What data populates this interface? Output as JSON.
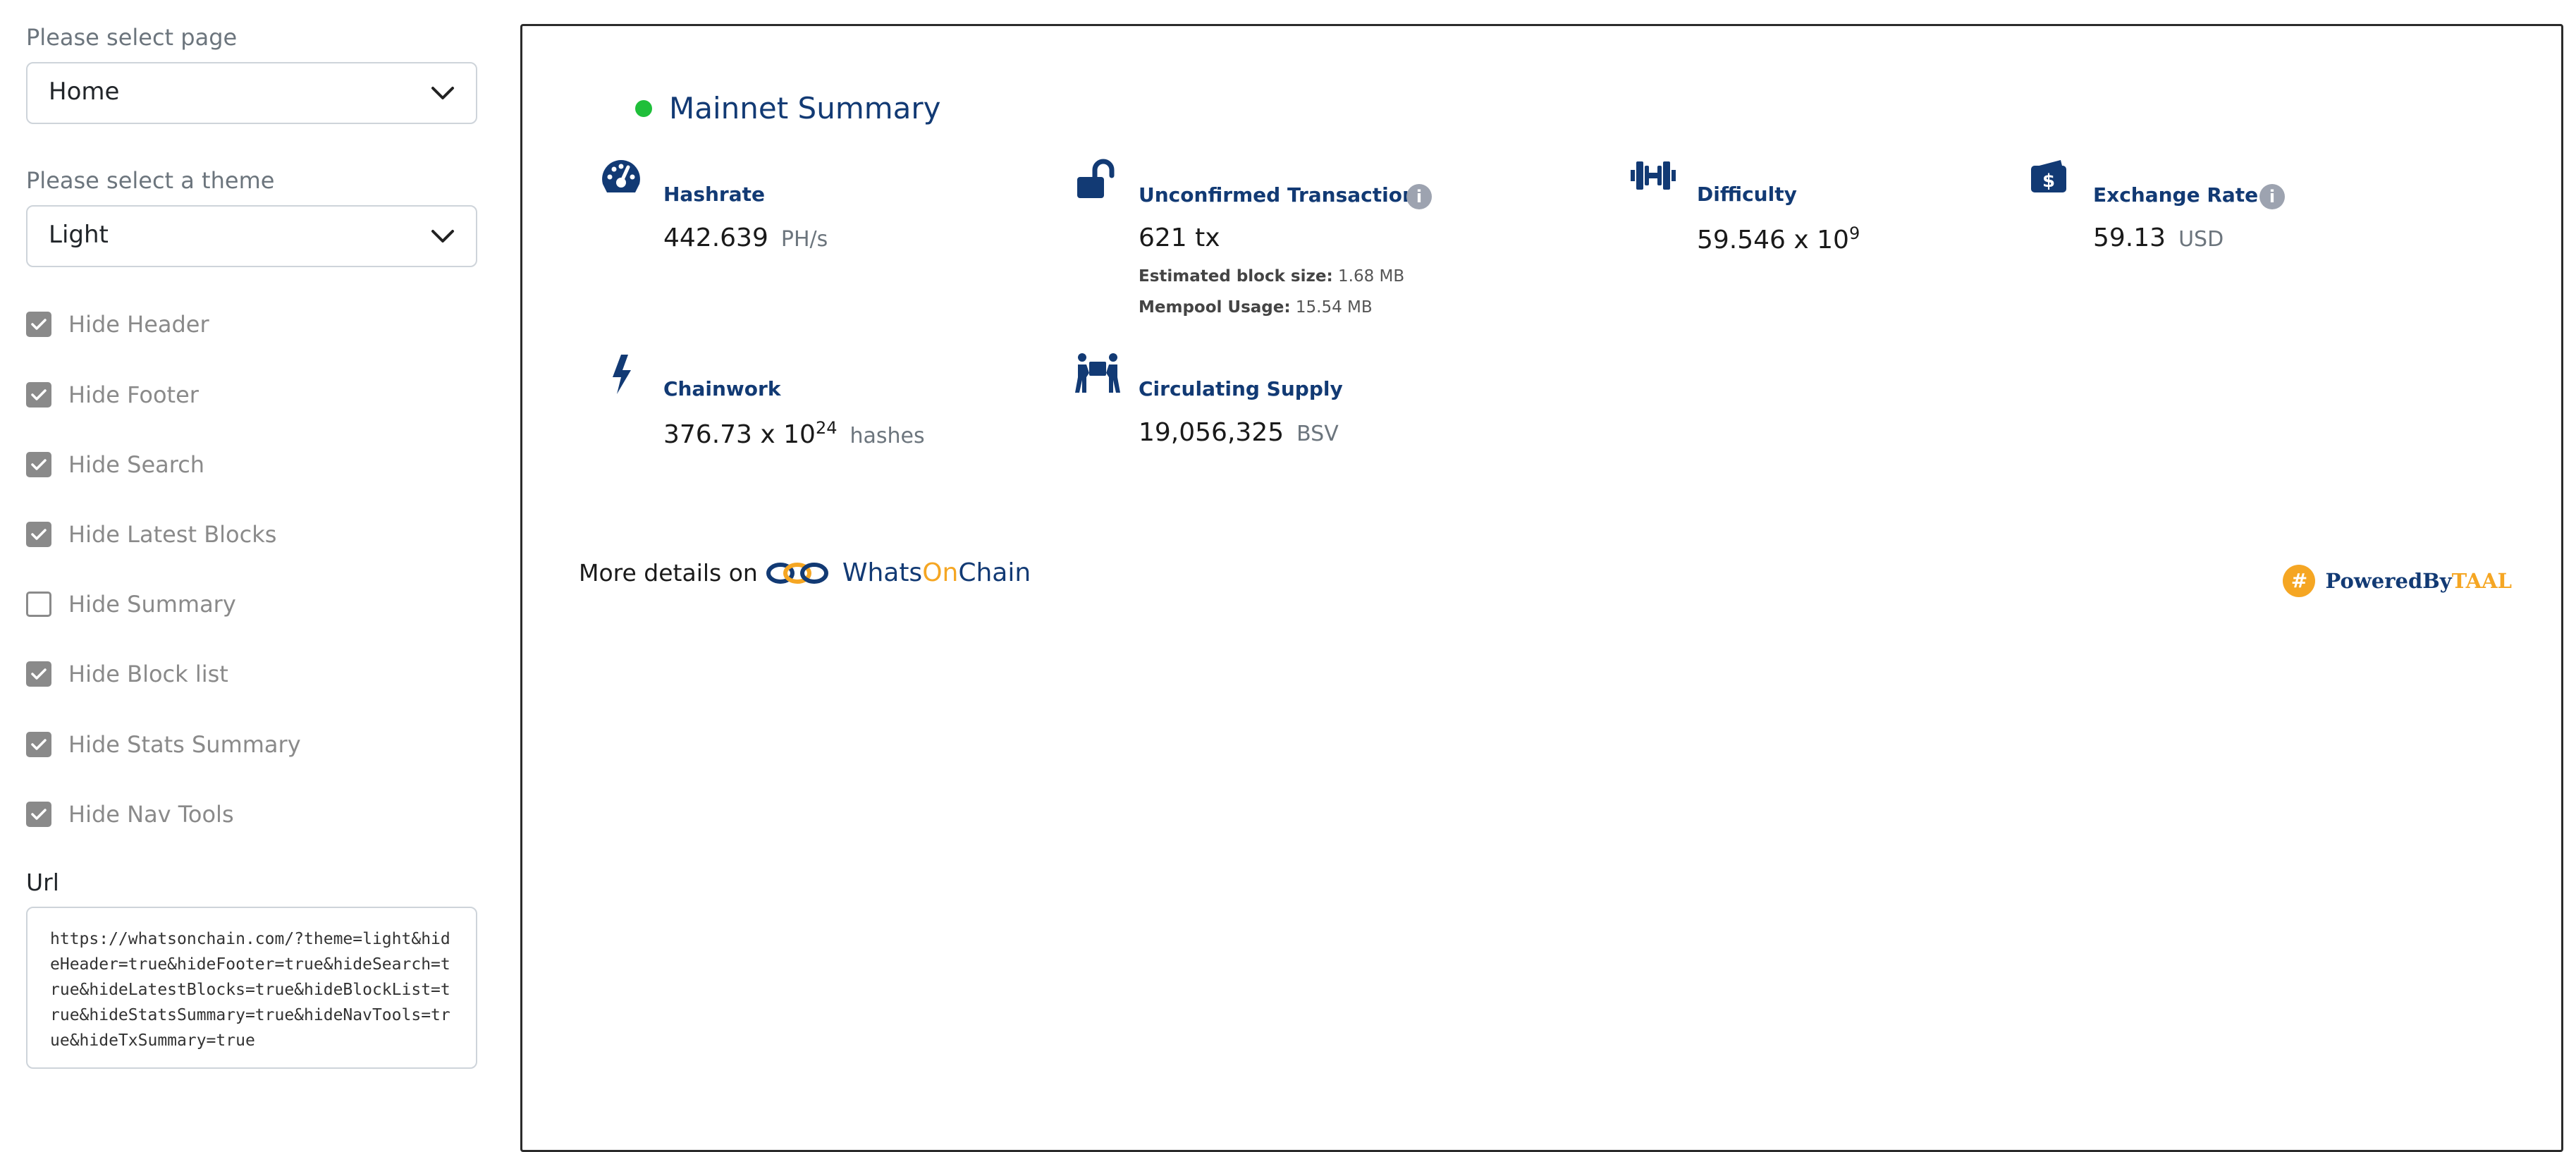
{
  "sidebar": {
    "page_select": {
      "label": "Please select page",
      "value": "Home"
    },
    "theme_select": {
      "label": "Please select a theme",
      "value": "Light"
    },
    "checkboxes": [
      {
        "label": "Hide Header",
        "checked": true
      },
      {
        "label": "Hide Footer",
        "checked": true
      },
      {
        "label": "Hide Search",
        "checked": true
      },
      {
        "label": "Hide Latest Blocks",
        "checked": true
      },
      {
        "label": "Hide Summary",
        "checked": false
      },
      {
        "label": "Hide Block list",
        "checked": true
      },
      {
        "label": "Hide Stats Summary",
        "checked": true
      },
      {
        "label": "Hide Nav Tools",
        "checked": true
      }
    ],
    "url": {
      "label": "Url",
      "value": "https://whatsonchain.com/?theme=light&hideHeader=true&hideFooter=true&hideSearch=true&hideLatestBlocks=true&hideBlockList=true&hideStatsSummary=true&hideNavTools=true&hideTxSummary=true"
    }
  },
  "summary": {
    "title": "Mainnet Summary",
    "status_color": "#1fbf3a",
    "hashrate": {
      "label": "Hashrate",
      "value": "442.639",
      "unit": "PH/s",
      "icon": "speedometer-icon"
    },
    "unconfirmed": {
      "label": "Unconfirmed Transactions",
      "value": "621 tx",
      "block_size_label": "Estimated block size:",
      "block_size_value": "1.68 MB",
      "mempool_label": "Mempool Usage:",
      "mempool_value": "15.54 MB",
      "icon": "unlock-icon"
    },
    "difficulty": {
      "label": "Difficulty",
      "mantissa": "59.546 x 10",
      "exponent": "9",
      "icon": "dumbbell-icon"
    },
    "exchange_rate": {
      "label": "Exchange Rate",
      "value": "59.13",
      "unit": "USD",
      "icon": "wallet-icon"
    },
    "chainwork": {
      "label": "Chainwork",
      "mantissa": "376.73 x 10",
      "exponent": "24",
      "unit": "hashes",
      "icon": "bolt-icon"
    },
    "supply": {
      "label": "Circulating Supply",
      "value": "19,056,325",
      "unit": "BSV",
      "icon": "people-carry-icon"
    },
    "info_glyph": "i"
  },
  "footer": {
    "more_details": "More details on",
    "woc_part1": "Whats",
    "woc_part2": "On",
    "woc_part3": "Chain",
    "powered_by": "PoweredBy",
    "taal": "TAAL",
    "coin_glyph": "#"
  },
  "colors": {
    "brand_navy": "#123a74",
    "accent_orange": "#f5a623",
    "checkbox_gray": "#8a8a8a"
  }
}
